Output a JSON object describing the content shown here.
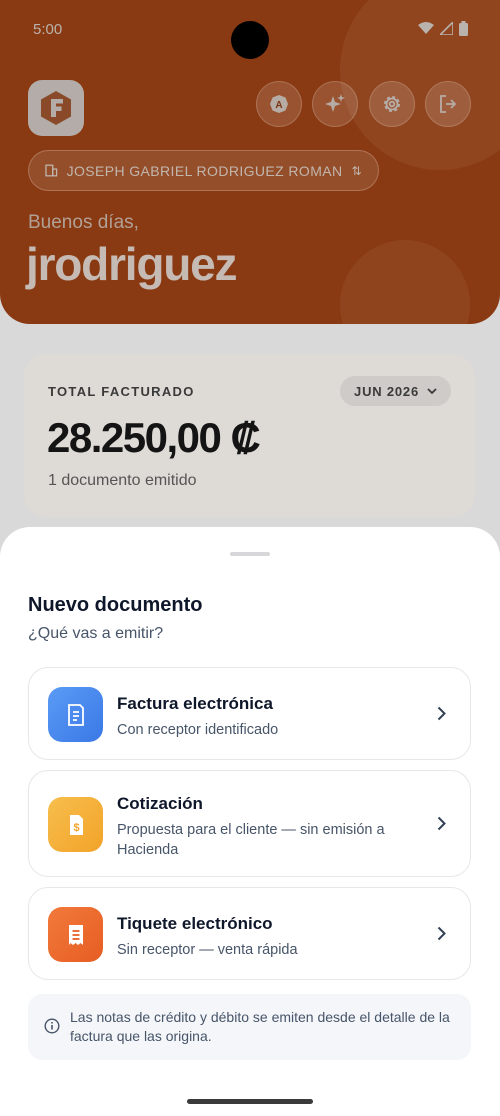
{
  "status": {
    "time": "5:00"
  },
  "header": {
    "company": "JOSEPH GABRIEL RODRIGUEZ ROMAN",
    "greeting": "Buenos días,",
    "username": "jrodriguez"
  },
  "icons": {
    "logo": "invoice-logo-icon",
    "translate": "translate-icon",
    "sparkle": "sparkle-icon",
    "settings": "gear-icon",
    "logout": "logout-icon"
  },
  "summary": {
    "label": "TOTAL FACTURADO",
    "month": "JUN 2026",
    "amount": "28.250,00 ₡",
    "docs": "1 documento emitido"
  },
  "sheet": {
    "title": "Nuevo documento",
    "subtitle": "¿Qué vas a emitir?",
    "options": [
      {
        "title": "Factura electrónica",
        "desc": "Con receptor identificado",
        "color": "#4f8df0",
        "icon": "receipt-icon"
      },
      {
        "title": "Cotización",
        "desc": "Propuesta para el cliente — sin emisión a Hacienda",
        "color": "#f5b23a",
        "icon": "quote-document-icon"
      },
      {
        "title": "Tiquete electrónico",
        "desc": "Sin receptor — venta rápida",
        "color": "#ee6b2f",
        "icon": "ticket-icon"
      }
    ],
    "note": "Las notas de crédito y débito se emiten desde el detalle de la factura que las origina."
  },
  "colors": {
    "accent": "#e0601f",
    "header_dimmed": "#8a3a12"
  }
}
